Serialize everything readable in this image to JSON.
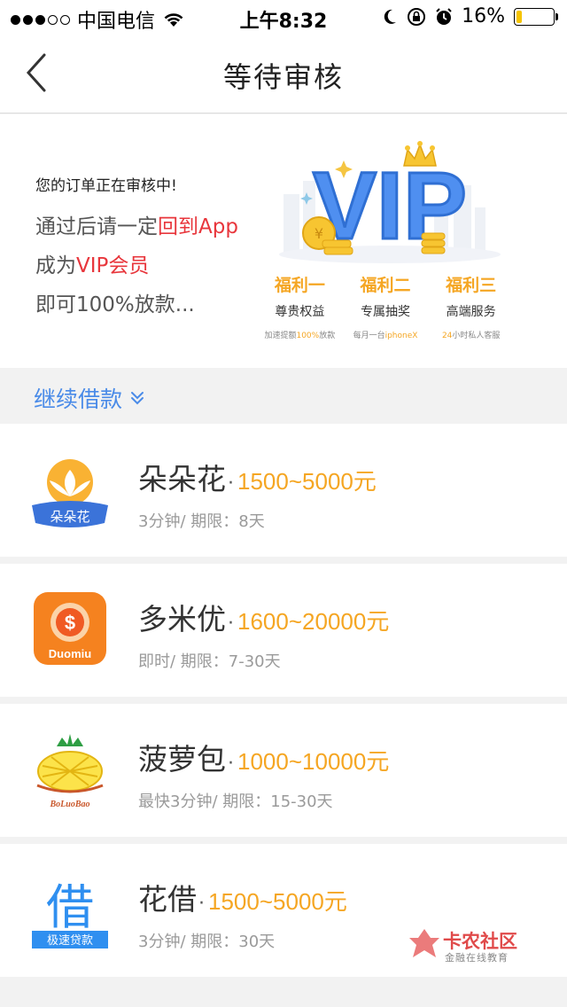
{
  "status_bar": {
    "carrier": "中国电信",
    "time": "上午8:32",
    "battery": "16%",
    "battery_level": 0.16
  },
  "nav": {
    "title": "等待审核"
  },
  "banner": {
    "title": "您的订单正在审核中!",
    "line1_prefix": "通过后请一定",
    "line1_highlight": "回到App",
    "line2_prefix": "成为",
    "line2_highlight": "VIP会员",
    "line3": "即可100%放款...",
    "vip_text": "VIP",
    "benefits": [
      {
        "title": "福利一",
        "subtitle": "尊贵权益",
        "note_a": "加速提额",
        "note_hl": "100%",
        "note_b": "放款"
      },
      {
        "title": "福利二",
        "subtitle": "专属抽奖",
        "note_a": "每月一台",
        "note_hl": "iphoneX",
        "note_b": ""
      },
      {
        "title": "福利三",
        "subtitle": "高端服务",
        "note_a": "",
        "note_hl": "24",
        "note_b": "小时私人客服"
      }
    ]
  },
  "section": {
    "label": "继续借款"
  },
  "loans": [
    {
      "name": "朵朵花",
      "amount": "1500~5000元",
      "meta": "3分钟/ 期限：8天",
      "logo_text": "朵朵花"
    },
    {
      "name": "多米优",
      "amount": "1600~20000元",
      "meta": "即时/ 期限：7-30天",
      "logo_text": "Duomiu"
    },
    {
      "name": "菠萝包",
      "amount": "1000~10000元",
      "meta": "最快3分钟/ 期限：15-30天",
      "logo_text": "BoLuoBao"
    },
    {
      "name": "花借",
      "amount": "1500~5000元",
      "meta": "3分钟/ 期限：30天",
      "logo_text": "借",
      "logo_sub": "极速贷款"
    }
  ],
  "watermark": {
    "title": "卡农社区",
    "subtitle": "金融在线教育"
  },
  "colors": {
    "accent_blue": "#4a8be8",
    "amount_orange": "#f5a623",
    "highlight_red": "#e8363c"
  }
}
